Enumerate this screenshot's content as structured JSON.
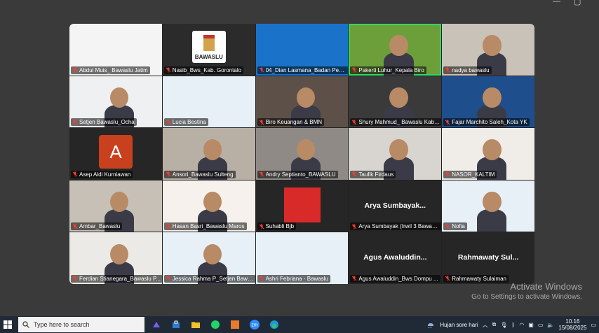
{
  "window": {
    "controls": [
      "—",
      "▢"
    ]
  },
  "participants": [
    {
      "name": "Abdul Muis_ Bawaslu Jatim",
      "bg": "#f4f4f4",
      "kind": "slide"
    },
    {
      "name": "Nasib_Bws_Kab. Gorontalo",
      "bg": "#2b2b2b",
      "kind": "logo",
      "logo_text": "BAWASLU"
    },
    {
      "name": "04_Dian Lasmana_Badan Peng...",
      "bg": "#1a73c9",
      "kind": "slide"
    },
    {
      "name": "Pakerti Luhur_Kepala Biro",
      "bg": "#6c9f3a",
      "kind": "person",
      "active": true
    },
    {
      "name": "nadya bawaslu",
      "bg": "#c9c2b8",
      "kind": "person"
    },
    {
      "name": "Setjen Bawaslu_Ocha",
      "bg": "#eef0f2",
      "kind": "person"
    },
    {
      "name": "Lucia Bestina",
      "bg": "#e7f0f6",
      "kind": "slide"
    },
    {
      "name": "Biro Keuangan & BMN",
      "bg": "#5c5048",
      "kind": "person"
    },
    {
      "name": "Shury Mahmud_ Bawaslu Kab....",
      "bg": "#3a3a3a",
      "kind": "person"
    },
    {
      "name": "Fajar Marchito Saleh_Kota YK",
      "bg": "#1e4e8c",
      "kind": "person"
    },
    {
      "name": "Asep Aldi Kurniawan",
      "bg": "#262626",
      "kind": "avatar",
      "initial": "A"
    },
    {
      "name": "Ansori_Bawaslu Sulteng",
      "bg": "#b9b0a5",
      "kind": "person"
    },
    {
      "name": "Andry Septianto_BAWASLU",
      "bg": "#8f8a86",
      "kind": "person"
    },
    {
      "name": "Taufik Firdaus",
      "bg": "#d8d4cf",
      "kind": "person"
    },
    {
      "name": "NASOR_KALTIM",
      "bg": "#f0ede8",
      "kind": "person"
    },
    {
      "name": "Ambar_Bawaslu",
      "bg": "#c7c0b6",
      "kind": "person"
    },
    {
      "name": "Hasan Basri_Bawaslu Maros",
      "bg": "#f6f1ec",
      "kind": "person"
    },
    {
      "name": "Suhabli Bjb",
      "bg": "#262626",
      "kind": "photo"
    },
    {
      "name": "Arya Sumbayak (Irwil 3 Bawasl...",
      "bg": "#262626",
      "kind": "text",
      "display": "Arya Sumbayak..."
    },
    {
      "name": "Nofia",
      "bg": "#e7f0f6",
      "kind": "person"
    },
    {
      "name": "Ferdian Stianegara_Bawaslu P...",
      "bg": "#eceae6",
      "kind": "person"
    },
    {
      "name": "Jessica Rahma P_Setjen Bawa...",
      "bg": "#e7f0f6",
      "kind": "person"
    },
    {
      "name": "Ashri Febriana - Bawaslu",
      "bg": "#e7f0f6",
      "kind": "slide"
    },
    {
      "name": "Agus Awaluddin_Bws Dompu ...",
      "bg": "#262626",
      "kind": "text",
      "display": "Agus Awaluddin..."
    },
    {
      "name": "Rahmawaty Sulaiman",
      "bg": "#262626",
      "kind": "text",
      "display": "Rahmawaty Sul..."
    }
  ],
  "watermark": {
    "line1": "Activate Windows",
    "line2": "Go to Settings to activate Windows."
  },
  "taskbar": {
    "search_placeholder": "Type here to search",
    "weather": "Hujan sore hari",
    "time": "10.16",
    "date": "15/08/2025",
    "apps": [
      "copilot",
      "store",
      "files",
      "whatsapp",
      "sketch",
      "zm",
      "edge"
    ]
  }
}
